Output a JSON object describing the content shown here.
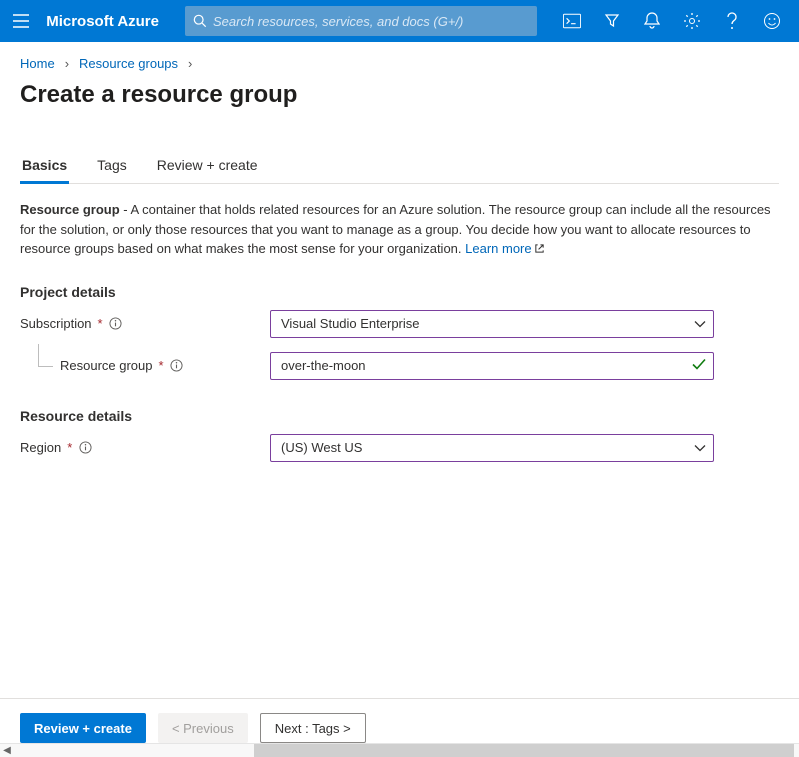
{
  "header": {
    "brand": "Microsoft Azure",
    "search_placeholder": "Search resources, services, and docs (G+/)"
  },
  "breadcrumb": {
    "items": [
      "Home",
      "Resource groups"
    ]
  },
  "page": {
    "title": "Create a resource group"
  },
  "tabs": [
    {
      "label": "Basics",
      "active": true
    },
    {
      "label": "Tags",
      "active": false
    },
    {
      "label": "Review + create",
      "active": false
    }
  ],
  "description": {
    "lead": "Resource group",
    "body": " - A container that holds related resources for an Azure solution. The resource group can include all the resources for the solution, or only those resources that you want to manage as a group. You decide how you want to allocate resources to resource groups based on what makes the most sense for your organization. ",
    "learn_more": "Learn more"
  },
  "sections": {
    "project_details_title": "Project details",
    "resource_details_title": "Resource details"
  },
  "fields": {
    "subscription": {
      "label": "Subscription",
      "value": "Visual Studio Enterprise"
    },
    "resource_group": {
      "label": "Resource group",
      "value": "over-the-moon"
    },
    "region": {
      "label": "Region",
      "value": "(US) West US"
    }
  },
  "footer": {
    "review_create": "Review + create",
    "previous": "< Previous",
    "next": "Next : Tags >"
  }
}
